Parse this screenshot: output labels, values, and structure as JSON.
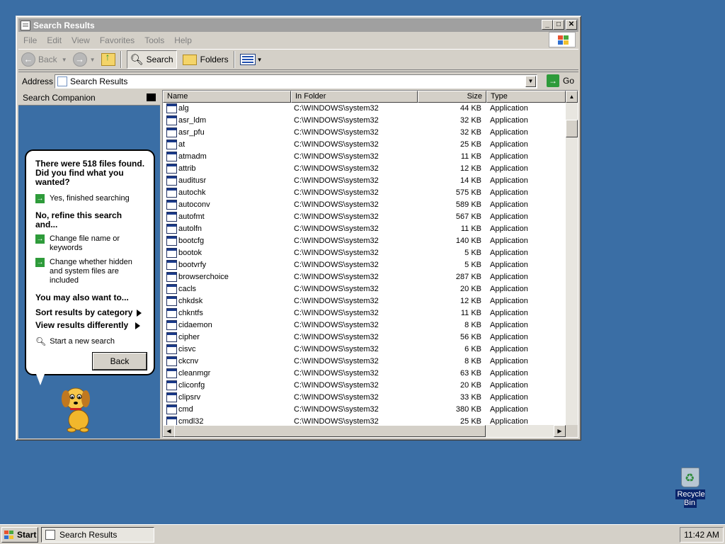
{
  "window": {
    "title": "Search Results",
    "menu": [
      "File",
      "Edit",
      "View",
      "Favorites",
      "Tools",
      "Help"
    ],
    "toolbar": {
      "back": "Back",
      "search": "Search",
      "folders": "Folders"
    },
    "address": {
      "label": "Address",
      "value": "Search Results",
      "go": "Go"
    }
  },
  "companion": {
    "header": "Search Companion",
    "found": "There were 518 files found. Did you find what you wanted?",
    "yes": "Yes, finished searching",
    "refine": "No, refine this search and...",
    "change_name": "Change file name or keywords",
    "change_hidden": "Change whether hidden and system files are included",
    "also": "You may also want to...",
    "sort": "Sort results by category",
    "view": "View results differently",
    "new_search": "Start a new search",
    "back": "Back"
  },
  "list": {
    "columns": [
      "Name",
      "In Folder",
      "Size",
      "Type"
    ],
    "rows": [
      {
        "name": "alg",
        "folder": "C:\\WINDOWS\\system32",
        "size": "44 KB",
        "type": "Application"
      },
      {
        "name": "asr_ldm",
        "folder": "C:\\WINDOWS\\system32",
        "size": "32 KB",
        "type": "Application"
      },
      {
        "name": "asr_pfu",
        "folder": "C:\\WINDOWS\\system32",
        "size": "32 KB",
        "type": "Application"
      },
      {
        "name": "at",
        "folder": "C:\\WINDOWS\\system32",
        "size": "25 KB",
        "type": "Application"
      },
      {
        "name": "atmadm",
        "folder": "C:\\WINDOWS\\system32",
        "size": "11 KB",
        "type": "Application"
      },
      {
        "name": "attrib",
        "folder": "C:\\WINDOWS\\system32",
        "size": "12 KB",
        "type": "Application"
      },
      {
        "name": "auditusr",
        "folder": "C:\\WINDOWS\\system32",
        "size": "14 KB",
        "type": "Application"
      },
      {
        "name": "autochk",
        "folder": "C:\\WINDOWS\\system32",
        "size": "575 KB",
        "type": "Application"
      },
      {
        "name": "autoconv",
        "folder": "C:\\WINDOWS\\system32",
        "size": "589 KB",
        "type": "Application"
      },
      {
        "name": "autofmt",
        "folder": "C:\\WINDOWS\\system32",
        "size": "567 KB",
        "type": "Application"
      },
      {
        "name": "autolfn",
        "folder": "C:\\WINDOWS\\system32",
        "size": "11 KB",
        "type": "Application"
      },
      {
        "name": "bootcfg",
        "folder": "C:\\WINDOWS\\system32",
        "size": "140 KB",
        "type": "Application"
      },
      {
        "name": "bootok",
        "folder": "C:\\WINDOWS\\system32",
        "size": "5 KB",
        "type": "Application"
      },
      {
        "name": "bootvrfy",
        "folder": "C:\\WINDOWS\\system32",
        "size": "5 KB",
        "type": "Application"
      },
      {
        "name": "browserchoice",
        "folder": "C:\\WINDOWS\\system32",
        "size": "287 KB",
        "type": "Application"
      },
      {
        "name": "cacls",
        "folder": "C:\\WINDOWS\\system32",
        "size": "20 KB",
        "type": "Application"
      },
      {
        "name": "chkdsk",
        "folder": "C:\\WINDOWS\\system32",
        "size": "12 KB",
        "type": "Application"
      },
      {
        "name": "chkntfs",
        "folder": "C:\\WINDOWS\\system32",
        "size": "11 KB",
        "type": "Application"
      },
      {
        "name": "cidaemon",
        "folder": "C:\\WINDOWS\\system32",
        "size": "8 KB",
        "type": "Application"
      },
      {
        "name": "cipher",
        "folder": "C:\\WINDOWS\\system32",
        "size": "56 KB",
        "type": "Application"
      },
      {
        "name": "cisvc",
        "folder": "C:\\WINDOWS\\system32",
        "size": "6 KB",
        "type": "Application"
      },
      {
        "name": "ckcnv",
        "folder": "C:\\WINDOWS\\system32",
        "size": "8 KB",
        "type": "Application"
      },
      {
        "name": "cleanmgr",
        "folder": "C:\\WINDOWS\\system32",
        "size": "63 KB",
        "type": "Application"
      },
      {
        "name": "cliconfg",
        "folder": "C:\\WINDOWS\\system32",
        "size": "20 KB",
        "type": "Application"
      },
      {
        "name": "clipsrv",
        "folder": "C:\\WINDOWS\\system32",
        "size": "33 KB",
        "type": "Application"
      },
      {
        "name": "cmd",
        "folder": "C:\\WINDOWS\\system32",
        "size": "380 KB",
        "type": "Application"
      },
      {
        "name": "cmdl32",
        "folder": "C:\\WINDOWS\\system32",
        "size": "25 KB",
        "type": "Application"
      }
    ]
  },
  "desktop": {
    "recycle_bin": "Recycle Bin"
  },
  "taskbar": {
    "start": "Start",
    "task": "Search Results",
    "clock": "11:42 AM"
  }
}
